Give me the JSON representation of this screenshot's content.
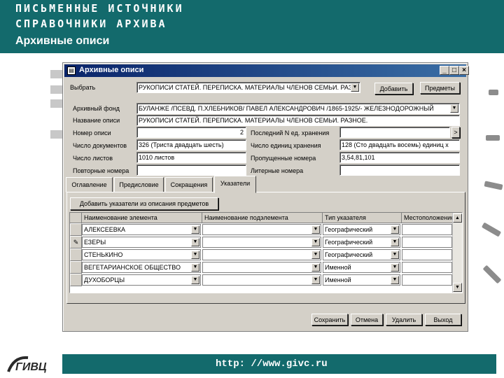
{
  "slide": {
    "header_line1": "ПИСЬМЕННЫЕ ИСТОЧНИКИ",
    "header_line2": "СПРАВОЧНИКИ АРХИВА",
    "subtitle": "Архивные описи",
    "footer_url": "http: //www.givc.ru",
    "logo_text": "ГИВЦ",
    "colors": {
      "header_bg": "#136a6c",
      "titlebar": "#0a246a",
      "window_bg": "#d4d0c8"
    }
  },
  "window": {
    "title": "Архивные описи",
    "controls": {
      "minimize": "_",
      "maximize": "□",
      "close": "×"
    }
  },
  "form": {
    "select_label": "Выбрать",
    "select_value": "РУКОПИСИ СТАТЕЙ. ПЕРЕПИСКА. МАТЕРИАЛЫ ЧЛЕНОВ СЕМЬИ. РАЗ",
    "add_button": "Добавить",
    "subjects_button": "Предметы",
    "fond_label": "Архивный фонд",
    "fond_value": "БУЛАНЖЕ /ПСЕВД. П.ХЛЕБНИКОВ/ ПАВЕЛ АЛЕКСАНДРОВИЧ /1865-1925/- ЖЕЛЕЗНОДОРОЖНЫЙ",
    "opis_name_label": "Название описи",
    "opis_name_value": "РУКОПИСИ СТАТЕЙ. ПЕРЕПИСКА. МАТЕРИАЛЫ ЧЛЕНОВ СЕМЬИ. РАЗНОЕ.",
    "opis_number_label": "Номер описи",
    "opis_number_value": "2",
    "last_unit_label": "Последний N ед. хранения",
    "last_unit_value": "",
    "last_unit_btn": ">",
    "docs_label": "Число документов",
    "docs_value": "326 (Триста двадцать шесть)",
    "units_label": "Число единиц хранения",
    "units_value": "128 (Сто двадцать восемь) единиц х",
    "sheets_label": "Число листов",
    "sheets_value": "1010 листов",
    "missed_label": "Пропущенные номера",
    "missed_value": "3,54,81,101",
    "repeat_label": "Повторные номера",
    "repeat_value": "",
    "letter_label": "Литерные номера",
    "letter_value": ""
  },
  "tabs": [
    "Оглавление",
    "Предисловие",
    "Сокращения",
    "Указатели"
  ],
  "active_tab": "Указатели",
  "pointers": {
    "add_button": "Добавить указатели из описания предметов",
    "columns": [
      "Наименование элемента",
      "Наименование подэлемента",
      "Тип указателя",
      "Местоположение"
    ],
    "rows": [
      {
        "marker": "",
        "element": "АЛЕКСЕЕВКА",
        "subelement": "",
        "type": "Географический",
        "location": ""
      },
      {
        "marker": "✎",
        "element": "ЕЗЕРЫ",
        "subelement": "",
        "type": "Географический",
        "location": ""
      },
      {
        "marker": "",
        "element": "СТЕНЬКИНО",
        "subelement": "",
        "type": "Географический",
        "location": ""
      },
      {
        "marker": "",
        "element": "ВЕГЕТАРИАНСКОЕ ОБЩЕСТВО",
        "subelement": "",
        "type": "Именной",
        "location": ""
      },
      {
        "marker": "",
        "element": "ДУХОБОРЦЫ",
        "subelement": "",
        "type": "Именной",
        "location": ""
      }
    ]
  },
  "actions": {
    "save": "Сохранить",
    "cancel": "Отмена",
    "delete": "Удалить",
    "exit": "Выход"
  }
}
